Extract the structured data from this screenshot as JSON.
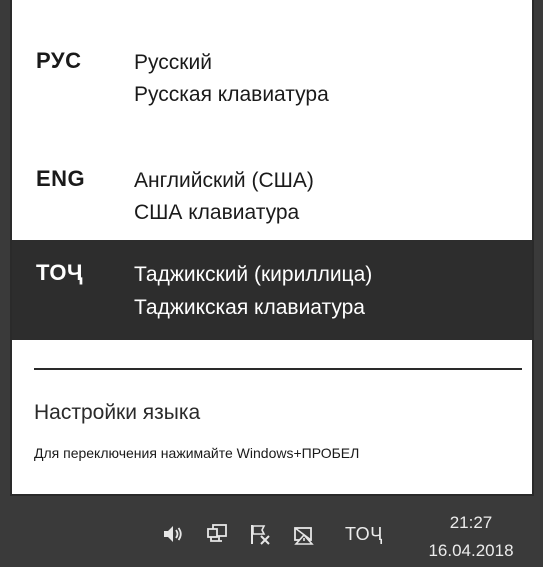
{
  "language_list": [
    {
      "code": "РУС",
      "name": "Русский",
      "keyboard": "Русская клавиатура",
      "selected": false
    },
    {
      "code": "ENG",
      "name": "Английский (США)",
      "keyboard": "США клавиатура",
      "selected": false
    },
    {
      "code": "ТОҶ",
      "name": "Таджикский (кириллица)",
      "keyboard": "Таджикская клавиатура",
      "selected": true
    }
  ],
  "footer": {
    "settings_label": "Настройки языка",
    "hint": "Для переключения нажимайте Windows+ПРОБЕЛ"
  },
  "taskbar": {
    "tray_icons": [
      "volume-icon",
      "network-icon",
      "action-center-flag-icon",
      "power-icon"
    ],
    "input_language": "ТОҶ",
    "time": "21:27",
    "date": "16.04.2018"
  },
  "colors": {
    "selected_background": "#2d2d2d",
    "taskbar_background": "#3a3a3a",
    "flyout_background": "#ffffff"
  }
}
